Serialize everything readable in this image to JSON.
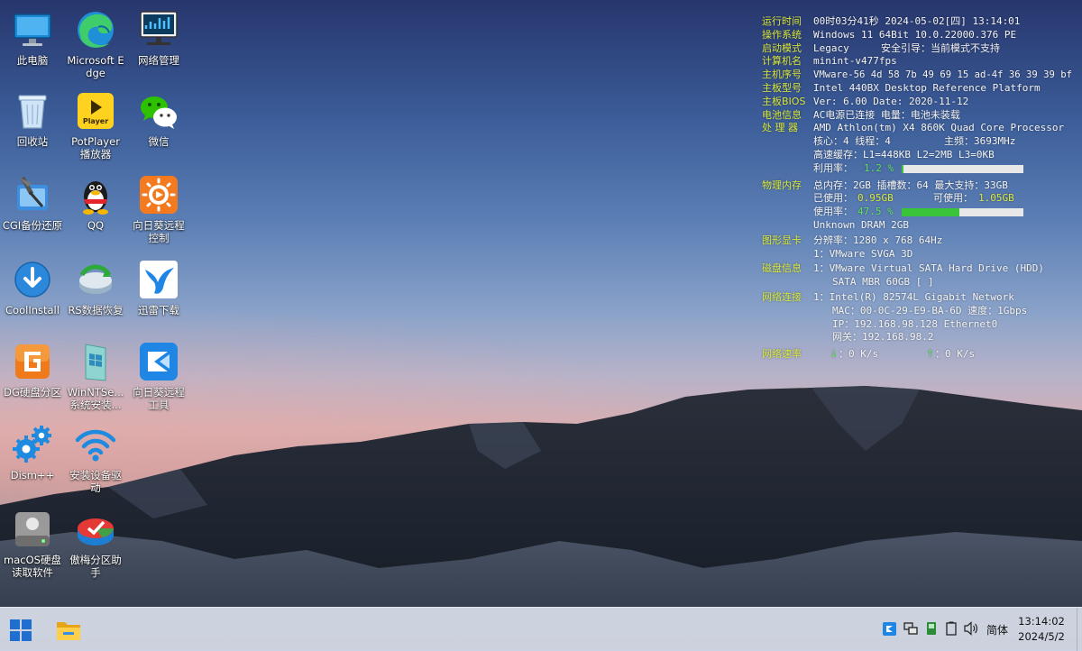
{
  "desktop": {
    "icons": [
      {
        "label": "此电脑"
      },
      {
        "label": "Microsoft Edge"
      },
      {
        "label": "网络管理"
      },
      {
        "label": "回收站"
      },
      {
        "label": "PotPlayer 播放器"
      },
      {
        "label": "微信"
      },
      {
        "label": "CGI备份还原"
      },
      {
        "label": "QQ"
      },
      {
        "label": "向日葵远程控制"
      },
      {
        "label": "CoolInstall"
      },
      {
        "label": "RS数据恢复"
      },
      {
        "label": "迅雷下载"
      },
      {
        "label": "DG硬盘分区"
      },
      {
        "label": "WinNTSe... 系统安装..."
      },
      {
        "label": "向日葵远程工具"
      },
      {
        "label": "Dism++"
      },
      {
        "label": "安装设备驱动"
      },
      {
        "label": "macOS硬盘读取软件"
      },
      {
        "label": "傲梅分区助手"
      }
    ],
    "potplayer_badge": "Player"
  },
  "sysinfo": {
    "runtime_key": "运行时间",
    "runtime_val": "00时03分41秒 2024-05-02[四] 13:14:01",
    "os_key": "操作系统",
    "os_val": "Windows 11 64Bit 10.0.22000.376 PE",
    "boot_key": "启动模式",
    "boot_val": "Legacy",
    "boot_val2": "安全引导：当前模式不支持",
    "pcname_key": "计算机名",
    "pcname_val": "minint-v477fps",
    "serial_key": "主机序号",
    "serial_val": "VMware-56 4d 58 7b 49 69 15 ad-4f 36 39 39 bf",
    "board_key": "主板型号",
    "board_val": "Intel 440BX Desktop Reference Platform",
    "bios_key": "主板BIOS",
    "bios_val": "Ver: 6.00  Date: 2020-11-12",
    "battery_key": "电池信息",
    "battery_val": "AC电源已连接  电量：电池未装载",
    "cpu_key": "处 理 器",
    "cpu_val": "AMD Athlon(tm) X4 860K Quad Core Processor",
    "cpu_cores": "核心：4  线程：4",
    "cpu_freq": "主频：3693MHz",
    "cpu_cache": "高速缓存：L1=448KB L2=2MB L3=0KB",
    "cpu_usage_label": "利用率：",
    "cpu_usage_val": "1.2 %",
    "cpu_usage_fraction": 0.012,
    "mem_key": "物理内存",
    "mem_total": "总内存：2GB 插槽数：64 最大支持：33GB",
    "mem_used_label": "已使用：",
    "mem_used_val": "0.95GB",
    "mem_avail_label": "可使用：",
    "mem_avail_val": "1.05GB",
    "mem_usage_label": "使用率：",
    "mem_usage_val": "47.5 %",
    "mem_usage_fraction": 0.475,
    "mem_type": "Unknown DRAM 2GB",
    "gpu_key": "图形显卡",
    "gpu_res": "分辨率：1280 x 768 64Hz",
    "gpu_name": "1：VMware SVGA 3D",
    "disk_key": "磁盘信息",
    "disk_line1": "1：VMware Virtual SATA Hard Drive (HDD)",
    "disk_line2": "SATA MBR 60GB [  ]",
    "net_key": "网络连接",
    "net_line1": "1：Intel(R) 82574L Gigabit Network",
    "net_line2": "MAC：00-0C-29-E9-BA-6D 速度：1Gbps",
    "net_line3": "IP：192.168.98.128 Ethernet0",
    "net_line4": "网关：192.168.98.2",
    "speed_key": "网络速率",
    "speed_down_val": "：0 K/s",
    "speed_up_val": "：0 K/s"
  },
  "taskbar": {
    "ime": "简体",
    "time": "13:14:02",
    "date": "2024/5/2"
  },
  "colors": {
    "accent_key": "#d9e83d",
    "usage_fill": "#39c43a",
    "taskbar_bg": "#d8deea"
  }
}
